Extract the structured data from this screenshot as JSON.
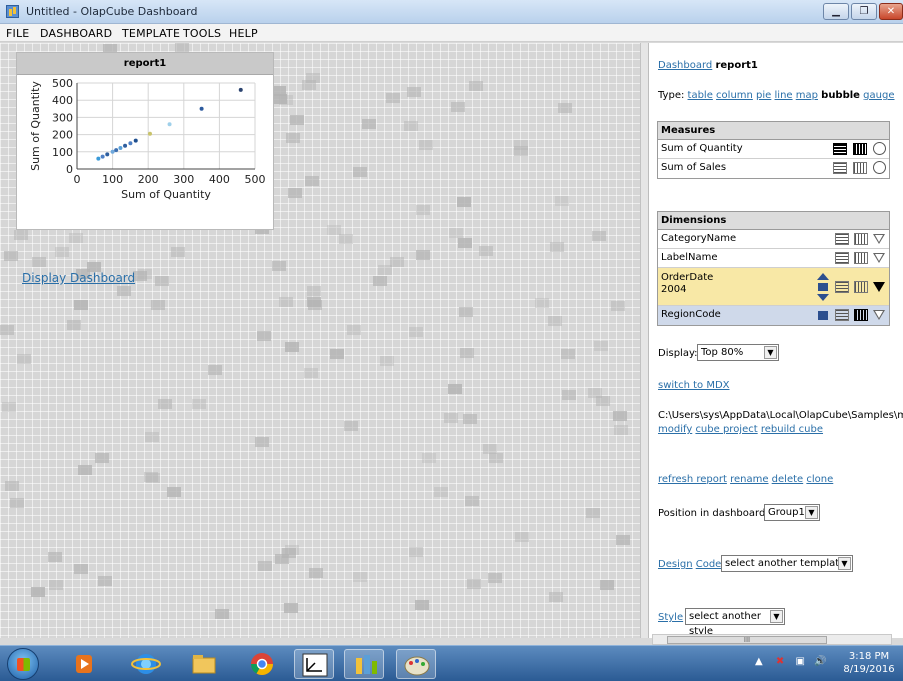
{
  "window": {
    "title": "Untitled - OlapCube Dashboard"
  },
  "menu": [
    "FILE",
    "DASHBOARD",
    "TEMPLATE",
    "TOOLS",
    "HELP"
  ],
  "report": {
    "title": "report1"
  },
  "chart_data": {
    "type": "scatter",
    "xlabel": "Sum of Quantity",
    "ylabel": "Sum of Quantity",
    "xlim": [
      0,
      500
    ],
    "ylim": [
      0,
      500
    ],
    "xticks": [
      0,
      100,
      200,
      300,
      400,
      500
    ],
    "yticks": [
      0,
      100,
      200,
      300,
      400,
      500
    ],
    "grid": true,
    "points": [
      {
        "x": 60,
        "y": 60,
        "color": "#3a9bd9"
      },
      {
        "x": 72,
        "y": 72,
        "color": "#4e7fc4"
      },
      {
        "x": 85,
        "y": 85,
        "color": "#2e5e9e"
      },
      {
        "x": 100,
        "y": 100,
        "color": "#6fa8dc"
      },
      {
        "x": 110,
        "y": 110,
        "color": "#3d6fb0"
      },
      {
        "x": 122,
        "y": 122,
        "color": "#5aa0d8"
      },
      {
        "x": 135,
        "y": 135,
        "color": "#2e5e9e"
      },
      {
        "x": 150,
        "y": 150,
        "color": "#4e7fc4"
      },
      {
        "x": 165,
        "y": 165,
        "color": "#1f4f8f"
      },
      {
        "x": 205,
        "y": 205,
        "color": "#c9c36a"
      },
      {
        "x": 260,
        "y": 260,
        "color": "#9fd0ea"
      },
      {
        "x": 350,
        "y": 350,
        "color": "#2c5a9e"
      },
      {
        "x": 460,
        "y": 460,
        "color": "#2c4470"
      }
    ]
  },
  "canvas": {
    "display_link": "Display Dashboard"
  },
  "panel": {
    "dashboard_prefix": "Dashboard",
    "report_name": "report1",
    "type_label": "Type:",
    "types": [
      {
        "label": "table",
        "active": false
      },
      {
        "label": "column",
        "active": false
      },
      {
        "label": "pie",
        "active": false
      },
      {
        "label": "line",
        "active": false
      },
      {
        "label": "map",
        "active": false
      },
      {
        "label": "bubble",
        "active": true
      },
      {
        "label": "gauge",
        "active": false
      }
    ],
    "measures_header": "Measures",
    "measures": [
      "Sum of Quantity",
      "Sum of Sales"
    ],
    "dimensions_header": "Dimensions",
    "dimensions": [
      "CategoryName",
      "LabelName",
      "OrderDate",
      "RegionCode"
    ],
    "orderdate_sub": "2004",
    "display_label": "Display:",
    "display_value": "Top 80%",
    "switch_mdx": "switch to MDX",
    "path": "C:\\Users\\sys\\AppData\\Local\\OlapCube\\Samples\\m",
    "modify": "modify",
    "cube_project": "cube project",
    "rebuild_cube": "rebuild cube",
    "refresh_report": "refresh report",
    "rename": "rename",
    "delete": "delete",
    "clone": "clone",
    "position_label": "Position in dashboard:",
    "position_value": "Group1",
    "design": "Design",
    "code": "Code",
    "template_select": "select another template",
    "style": "Style",
    "style_select": "select another style",
    "scroll_thumb": "III"
  },
  "taskbar": {
    "time": "3:18 PM",
    "date": "8/19/2016"
  },
  "colors": {
    "link": "#2a6fa8",
    "highlight_row": "#f8e8a6",
    "region_row": "#cfd9ea"
  }
}
